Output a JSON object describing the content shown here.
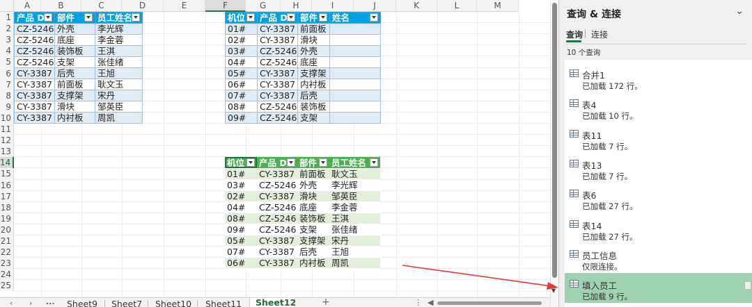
{
  "columns": [
    "A",
    "B",
    "C",
    "D",
    "E",
    "F",
    "G",
    "H",
    "I",
    "J",
    "K",
    "L",
    "M"
  ],
  "rows": [
    "1",
    "2",
    "3",
    "4",
    "5",
    "6",
    "7",
    "8",
    "9",
    "10",
    "11",
    "12",
    "13",
    "14",
    "15",
    "16",
    "17",
    "18",
    "19",
    "20",
    "21",
    "22",
    "23",
    "24",
    "25"
  ],
  "table1": {
    "headers": [
      "产品 D",
      "部件",
      "员工姓名"
    ],
    "rows": [
      [
        "CZ-5246",
        "外壳",
        "李光辉"
      ],
      [
        "CZ-5246",
        "底座",
        "李金蓉"
      ],
      [
        "CZ-5246",
        "装饰板",
        "王淇"
      ],
      [
        "CZ-5246",
        "支架",
        "张佳绪"
      ],
      [
        "CY-3387",
        "后壳",
        "王旭"
      ],
      [
        "CY-3387",
        "前面板",
        "耿文玉"
      ],
      [
        "CY-3387",
        "支撑架",
        "宋丹"
      ],
      [
        "CY-3387",
        "滑块",
        "邹英臣"
      ],
      [
        "CY-3387",
        "内衬板",
        "周凯"
      ]
    ]
  },
  "table2": {
    "headers": [
      "机位",
      "产品 D",
      "部件",
      "姓名"
    ],
    "rows": [
      [
        "01#",
        "CY-3387",
        "前面板",
        ""
      ],
      [
        "02#",
        "CY-3387",
        "滑块",
        ""
      ],
      [
        "03#",
        "CZ-5246",
        "外壳",
        ""
      ],
      [
        "04#",
        "CZ-5246",
        "底座",
        ""
      ],
      [
        "05#",
        "CY-3387",
        "支撑架",
        ""
      ],
      [
        "06#",
        "CY-3387",
        "内衬板",
        ""
      ],
      [
        "07#",
        "CY-3387",
        "后壳",
        ""
      ],
      [
        "08#",
        "CZ-5246",
        "装饰板",
        ""
      ],
      [
        "09#",
        "CZ-5246",
        "支架",
        ""
      ]
    ]
  },
  "table3": {
    "headers": [
      "机位",
      "产品 D",
      "部件",
      "员工姓名"
    ],
    "rows": [
      [
        "01#",
        "CY-3387",
        "前面板",
        "耿文玉"
      ],
      [
        "03#",
        "CZ-5246",
        "外壳",
        "李光辉"
      ],
      [
        "02#",
        "CY-3387",
        "滑块",
        "邹英臣"
      ],
      [
        "04#",
        "CZ-5246",
        "底座",
        "李金蓉"
      ],
      [
        "08#",
        "CZ-5246",
        "装饰板",
        "王淇"
      ],
      [
        "09#",
        "CZ-5246",
        "支架",
        "张佳绪"
      ],
      [
        "05#",
        "CY-3387",
        "支撑架",
        "宋丹"
      ],
      [
        "07#",
        "CY-3387",
        "后壳",
        "王旭"
      ],
      [
        "06#",
        "CY-3387",
        "内衬板",
        "周凯"
      ]
    ]
  },
  "sheet_tabs": {
    "more": "...",
    "items": [
      "Sheet9",
      "Sheet7",
      "Sheet10",
      "Sheet11",
      "Sheet12"
    ],
    "active": "Sheet12",
    "add": "+"
  },
  "pane": {
    "title": "查询 & 连接",
    "tab_queries": "查询",
    "tab_connections": "连接",
    "count": "10 个查询",
    "queries": [
      {
        "name": "合并1",
        "status": "已加载 172 行。"
      },
      {
        "name": "表4",
        "status": "已加载 10 行。"
      },
      {
        "name": "表11",
        "status": "已加载 7 行。"
      },
      {
        "name": "表13",
        "status": "已加载 7 行。"
      },
      {
        "name": "表6",
        "status": "已加载 27 行。"
      },
      {
        "name": "表14",
        "status": "已加载 27 行。"
      },
      {
        "name": "员工信息",
        "status": "仅限连接。"
      },
      {
        "name": "填入员工",
        "status": "已加载 9 行。",
        "selected": true
      }
    ]
  },
  "colors": {
    "excel_green": "#217346",
    "blue_header": "#00a0e3",
    "green_header": "#4caf50",
    "arrow": "#e53935",
    "selected_query": "#9dd3b0"
  }
}
